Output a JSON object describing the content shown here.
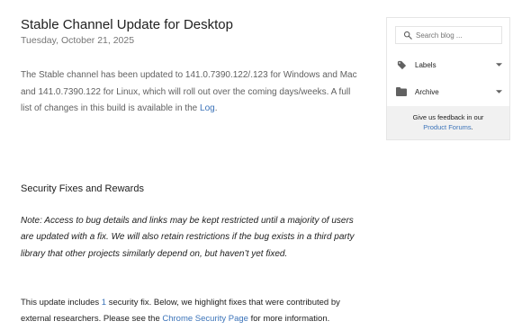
{
  "post": {
    "title": "Stable Channel Update for Desktop",
    "date": "Tuesday, October 21, 2025",
    "intro_text_1": "The Stable channel has been updated to 141.0.7390.122/.123 for Windows and Mac and 141.0.7390.122 for Linux, which will roll out over the coming days/weeks. A full list of changes in this build is available in the ",
    "intro_link": "Log",
    "intro_text_2": ".",
    "section_heading": "Security Fixes and Rewards",
    "note": "Note: Access to bug details and links may be kept restricted until a majority of users are updated with a fix. We will also retain restrictions if the bug exists in a third party library that other projects similarly depend on, but haven’t yet fixed.",
    "update_text_1": "This update includes ",
    "update_count": "1",
    "update_text_2": " security fix. Below, we highlight fixes that were contributed by external researchers. Please see the ",
    "update_link": "Chrome Security Page",
    "update_text_3": " for more information."
  },
  "sidebar": {
    "search_placeholder": "Search blog ...",
    "labels_label": "Labels",
    "archive_label": "Archive",
    "feedback_text": "Give us feedback in our",
    "feedback_link": "Product Forums",
    "feedback_suffix": "."
  },
  "icons": {
    "search": "search-icon",
    "labels": "label-tag-icon",
    "archive": "folder-icon",
    "caret": "caret-down-icon"
  },
  "colors": {
    "link": "#3b73b9",
    "icon": "#616161",
    "feedback_bg": "#f1f1f1"
  }
}
